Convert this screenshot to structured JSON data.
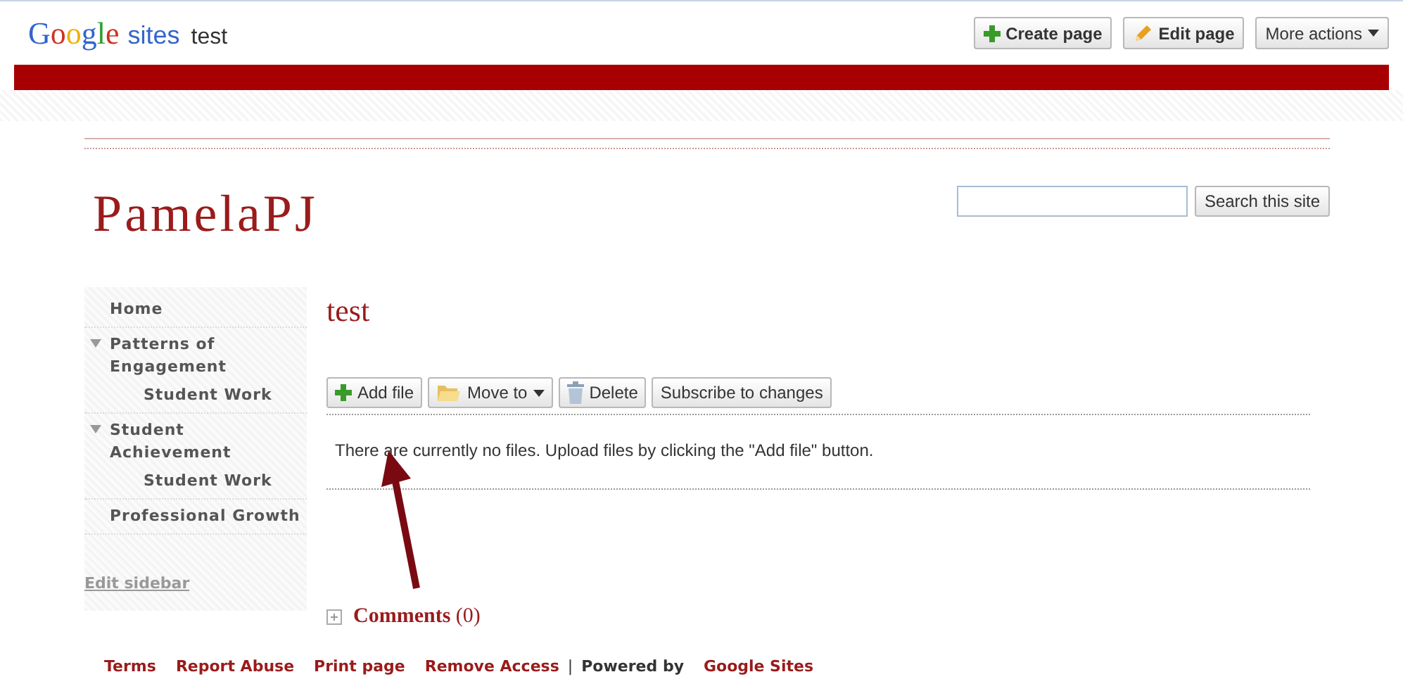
{
  "header": {
    "logo": {
      "brand": "Google",
      "product": "sites"
    },
    "site_name": "test",
    "actions": [
      {
        "label": "Create page",
        "kind": "create"
      },
      {
        "label": "Edit page",
        "kind": "edit"
      },
      {
        "label": "More actions",
        "kind": "menu"
      }
    ]
  },
  "site_title": "PamelaPJ",
  "search": {
    "button": "Search this site"
  },
  "sidebar": {
    "items": [
      {
        "label": "Home"
      },
      {
        "label": "Patterns of Engagement",
        "expanded": true,
        "children": [
          {
            "label": "Student Work"
          }
        ]
      },
      {
        "label": "Student Achievement",
        "expanded": true,
        "children": [
          {
            "label": "Student Work"
          }
        ]
      },
      {
        "label": "Professional Growth"
      }
    ],
    "edit_link": "Edit sidebar"
  },
  "page": {
    "title": "test",
    "toolbar": [
      {
        "label": "Add file",
        "kind": "add"
      },
      {
        "label": "Move to",
        "kind": "move"
      },
      {
        "label": "Delete",
        "kind": "delete"
      },
      {
        "label": "Subscribe to changes",
        "kind": "plain"
      }
    ],
    "message": "There are currently no files. Upload files by clicking the \"Add file\" button.",
    "comments": {
      "label": "Comments",
      "count": "(0)"
    }
  },
  "footer": {
    "links": [
      "Terms",
      "Report Abuse",
      "Print page",
      "Remove Access"
    ],
    "separator": "|",
    "powered": "Powered by",
    "powered_link": "Google Sites"
  }
}
